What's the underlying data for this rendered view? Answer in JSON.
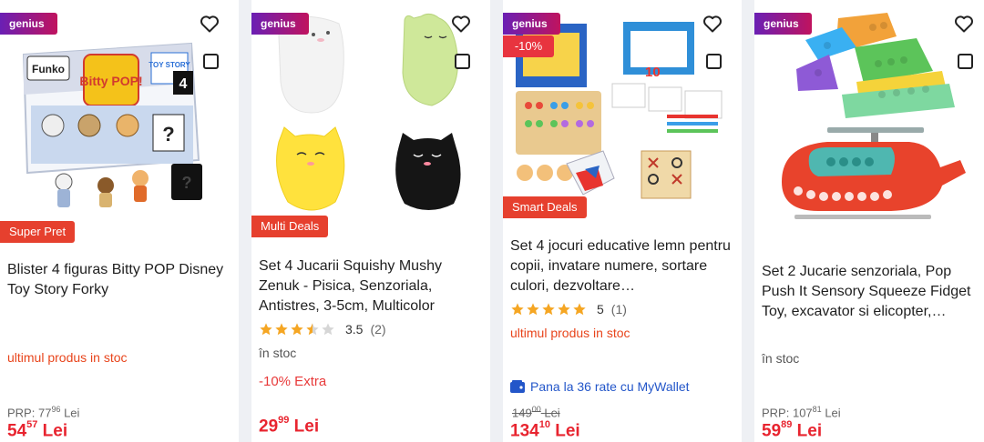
{
  "colors": {
    "price_red": "#e8242f",
    "stock_orange": "#e8451c",
    "wallet_blue": "#2356c9",
    "genius_from": "#6a1fb4",
    "genius_to": "#c0135e"
  },
  "products": [
    {
      "genius": "genius",
      "title": "Blister 4 figuras Bitty POP Disney Toy Story Forky",
      "deal": "Super Pret",
      "stock": "ultimul produs in stoc",
      "prp_label": "PRP:",
      "prp_int": "77",
      "prp_dec": "96",
      "prp_cur": "Lei",
      "price_int": "54",
      "price_dec": "57",
      "price_cur": "Lei",
      "box_label": "Bitty POP!",
      "brand": "Funko",
      "box_badge": "4",
      "box_text": "TOY STORY"
    },
    {
      "genius": "genius",
      "title": "Set 4 Jucarii Squishy Mushy Zenuk - Pisica, Senzoriala, Antistres, 3-5cm, Multicolor",
      "deal": "Multi Deals",
      "rating": 3.5,
      "rating_text": "3.5",
      "rating_count": "(2)",
      "stock": "în stoc",
      "extra": "-10% Extra",
      "price_int": "29",
      "price_dec": "99",
      "price_cur": "Lei"
    },
    {
      "genius": "genius",
      "discount": "-10%",
      "title": "Set 4 jocuri educative lemn pentru copii, invatare numere, sortare culori, dezvoltare…",
      "deal": "Smart Deals",
      "rating": 5,
      "rating_text": "5",
      "rating_count": "(1)",
      "stock": "ultimul produs in stoc",
      "wallet": "Pana la 36 rate cu MyWallet",
      "old_int": "149",
      "old_dec": "00",
      "old_cur": "Lei",
      "price_int": "134",
      "price_dec": "10",
      "price_cur": "Lei",
      "box_badge": "10"
    },
    {
      "genius": "genius",
      "title": "Set 2 Jucarie senzoriala, Pop Push It Sensory Squeeze Fidget Toy, excavator si elicopter,…",
      "stock": "în stoc",
      "prp_label": "PRP:",
      "prp_int": "107",
      "prp_dec": "81",
      "prp_cur": "Lei",
      "price_int": "59",
      "price_dec": "89",
      "price_cur": "Lei"
    }
  ]
}
